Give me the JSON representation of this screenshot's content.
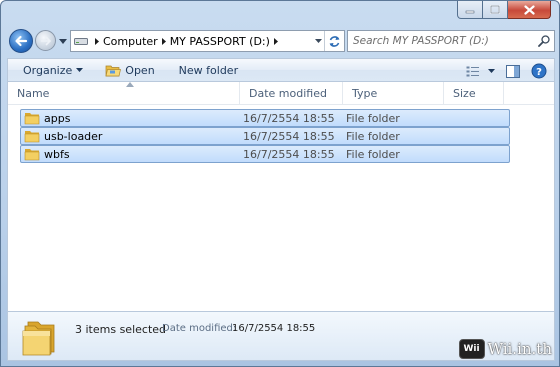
{
  "window": {
    "caption_buttons": [
      "minimize",
      "maximize",
      "close"
    ]
  },
  "address": {
    "breadcrumbs": [
      "Computer",
      "MY PASSPORT (D:)"
    ]
  },
  "search": {
    "placeholder": "Search MY PASSPORT (D:)"
  },
  "toolbar": {
    "organize_label": "Organize",
    "open_label": "Open",
    "new_folder_label": "New folder"
  },
  "columns": {
    "name": "Name",
    "date_modified": "Date modified",
    "type": "Type",
    "size": "Size"
  },
  "files": [
    {
      "name": "apps",
      "date_modified": "16/7/2554 18:55",
      "type": "File folder",
      "size": ""
    },
    {
      "name": "usb-loader",
      "date_modified": "16/7/2554 18:55",
      "type": "File folder",
      "size": ""
    },
    {
      "name": "wbfs",
      "date_modified": "16/7/2554 18:55",
      "type": "File folder",
      "size": ""
    }
  ],
  "details": {
    "selection_count": "3 items selected",
    "date_modified_label": "Date modified:",
    "date_modified_value": "16/7/2554 18:55"
  },
  "watermark": {
    "badge": "Wii",
    "text": "Wii.in.th"
  },
  "colors": {
    "selection_fill": "#c8dffb",
    "selection_border": "#7da2ce",
    "folder_yellow": "#f2cf5b",
    "close_red": "#c7493a"
  }
}
